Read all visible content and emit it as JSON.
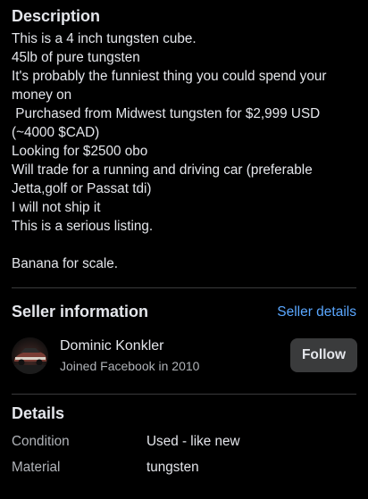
{
  "description": {
    "title": "Description",
    "lines": [
      "This is a 4 inch tungsten cube.",
      "45lb of pure tungsten",
      "It's probably the funniest thing you could spend your",
      "money on",
      " Purchased from Midwest tungsten for $2,999 USD",
      "(~4000 $CAD)",
      "Looking for $2500 obo",
      "Will trade for a running and driving car (preferable",
      "Jetta,golf or Passat tdi)",
      "I will not ship it",
      "This is a serious listing.",
      "",
      "Banana for scale."
    ]
  },
  "seller": {
    "title": "Seller information",
    "details_link": "Seller details",
    "name": "Dominic Konkler",
    "joined": "Joined Facebook in 2010",
    "follow_label": "Follow"
  },
  "details": {
    "title": "Details",
    "rows": [
      {
        "key": "Condition",
        "value": "Used - like new"
      },
      {
        "key": "Material",
        "value": "tungsten"
      }
    ]
  },
  "colors": {
    "background": "#000000",
    "text": "#e4e6eb",
    "secondary_text": "#b0b3b8",
    "link": "#5aa7ff",
    "button_bg": "#3a3b3c"
  }
}
